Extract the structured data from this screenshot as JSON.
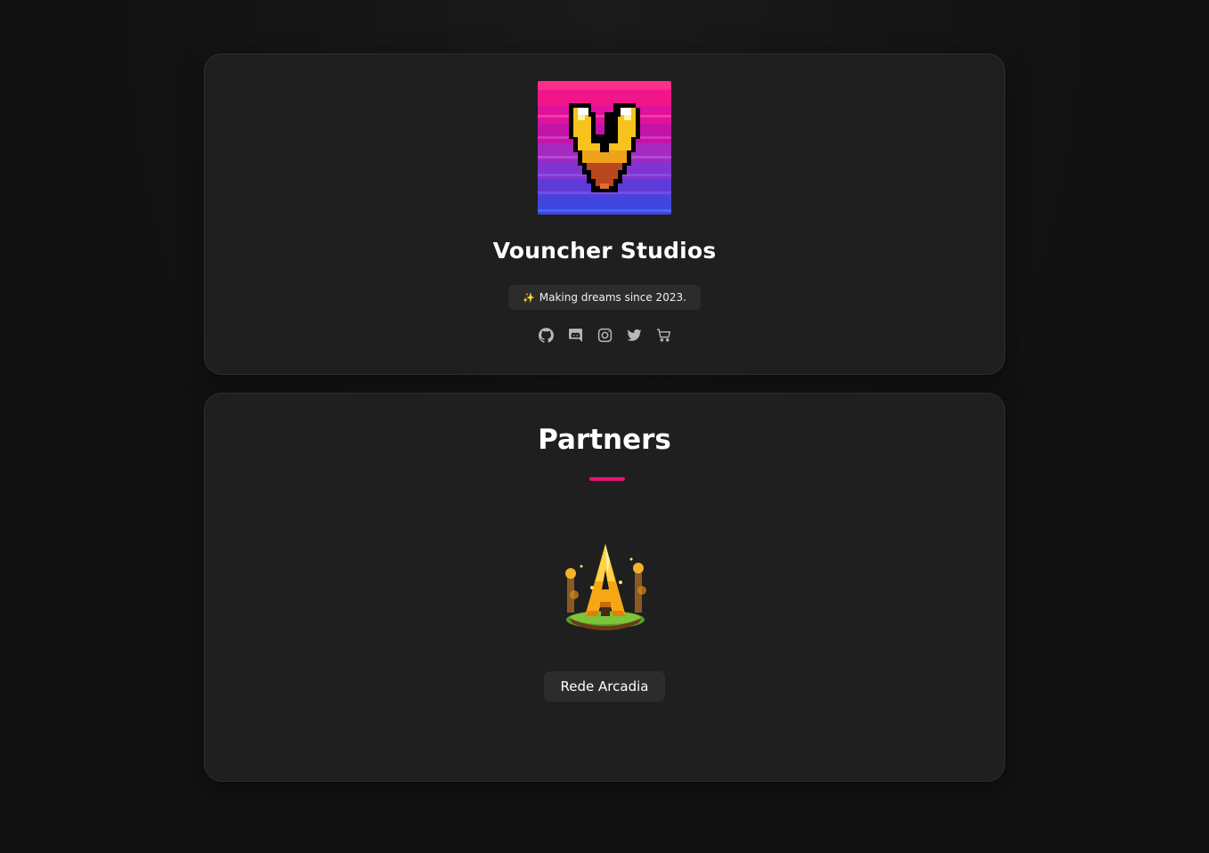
{
  "profile": {
    "name": "Vouncher Studios",
    "tagline_icon": "sparkles-icon",
    "tagline": "Making dreams since 2023.",
    "socials": [
      {
        "icon": "github-icon"
      },
      {
        "icon": "discord-icon"
      },
      {
        "icon": "instagram-icon"
      },
      {
        "icon": "twitter-icon"
      },
      {
        "icon": "cart-icon"
      }
    ]
  },
  "partners": {
    "title": "Partners",
    "items": [
      {
        "name": "Rede Arcadia"
      }
    ]
  },
  "colors": {
    "background": "#121212",
    "card": "#1f1f1f",
    "accent": "#e6137a",
    "chip": "#2c2c2c"
  }
}
